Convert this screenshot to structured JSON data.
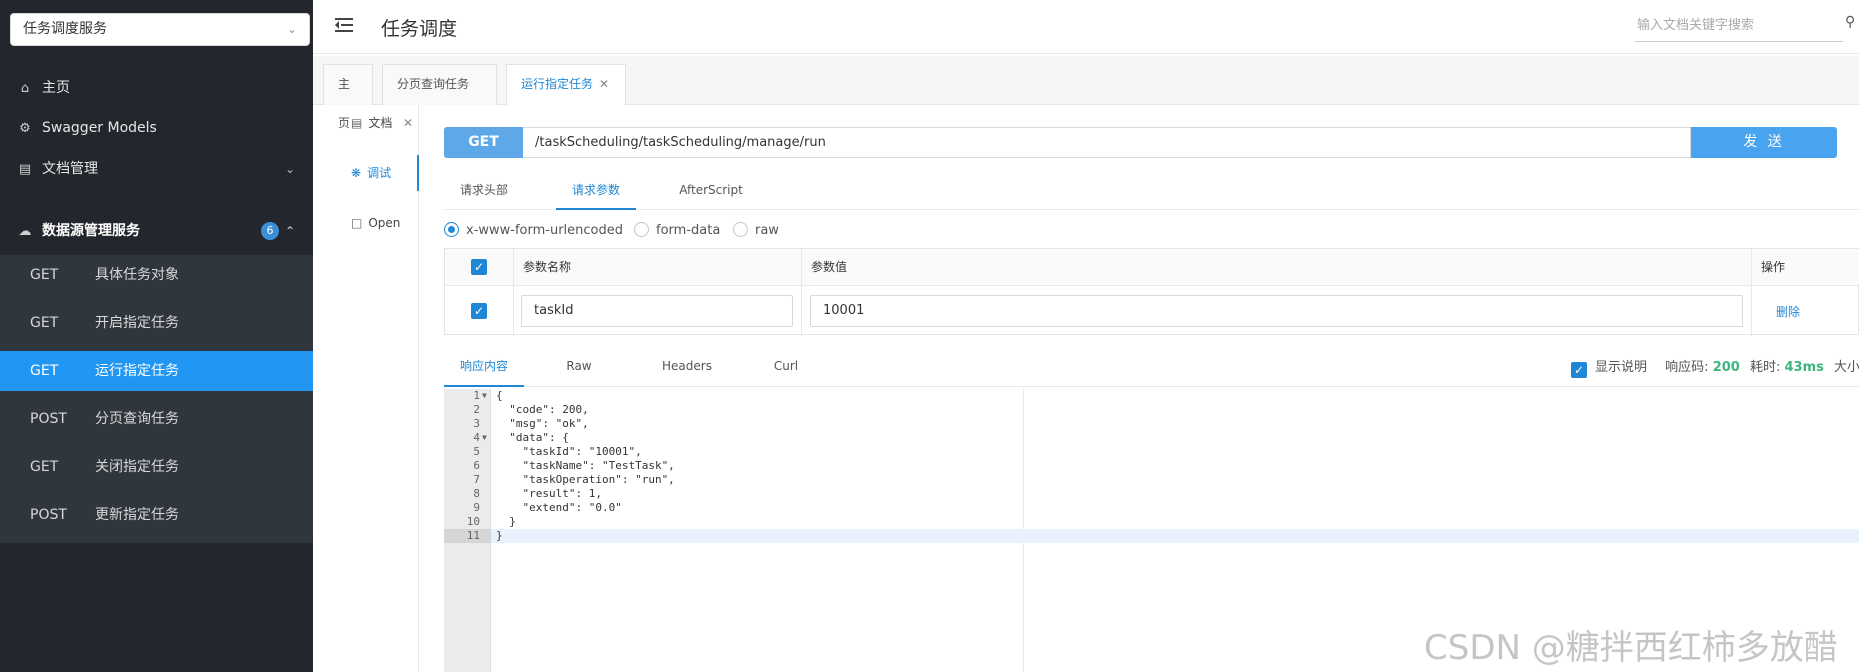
{
  "sidebar": {
    "service_select": "任务调度服务",
    "items": [
      {
        "label": "主页",
        "icon": "home-icon"
      },
      {
        "label": "Swagger Models",
        "icon": "gear-icon"
      },
      {
        "label": "文档管理",
        "icon": "document-icon"
      },
      {
        "label": "数据源管理服务",
        "icon": "cloud-icon",
        "badge": "6"
      }
    ],
    "submenu": [
      {
        "method": "GET",
        "label": "具体任务对象"
      },
      {
        "method": "GET",
        "label": "开启指定任务"
      },
      {
        "method": "GET",
        "label": "运行指定任务",
        "active": true
      },
      {
        "method": "POST",
        "label": "分页查询任务"
      },
      {
        "method": "GET",
        "label": "关闭指定任务"
      },
      {
        "method": "POST",
        "label": "更新指定任务"
      }
    ]
  },
  "header": {
    "title": "任务调度",
    "search_placeholder": "输入文档关键字搜索"
  },
  "tabs": [
    {
      "label": "主页"
    },
    {
      "label": "分页查询任务",
      "closable": true
    },
    {
      "label": "运行指定任务",
      "closable": true,
      "active": true
    }
  ],
  "inner_nav": [
    {
      "label": "文档",
      "icon": "document-icon"
    },
    {
      "label": "调试",
      "icon": "bug-icon",
      "active": true
    },
    {
      "label": "Open",
      "icon": "file-icon"
    }
  ],
  "request": {
    "method": "GET",
    "url": "/taskScheduling/taskScheduling/manage/run",
    "send_label": "发 送",
    "tabs": [
      "请求头部",
      "请求参数",
      "AfterScript"
    ],
    "active_tab": "请求参数",
    "content_types": [
      "x-www-form-urlencoded",
      "form-data",
      "raw"
    ],
    "selected_content_type": "x-www-form-urlencoded"
  },
  "params_table": {
    "headers": [
      "参数名称",
      "参数值",
      "操作"
    ],
    "rows": [
      {
        "name": "taskId",
        "value": "10001",
        "action": "删除",
        "checked": true
      }
    ]
  },
  "response": {
    "tabs": [
      "响应内容",
      "Raw",
      "Headers",
      "Curl"
    ],
    "active_tab": "响应内容",
    "show_desc_label": "显示说明",
    "status_label": "响应码:",
    "status_code": "200",
    "time_label": "耗时:",
    "time_value": "43ms",
    "size_label": "大小:",
    "line_numbers": [
      "1",
      "2",
      "3",
      "4",
      "5",
      "6",
      "7",
      "8",
      "9",
      "10",
      "11"
    ],
    "code_lines": [
      "{",
      "  \"code\": 200,",
      "  \"msg\": \"ok\",",
      "  \"data\": {",
      "    \"taskId\": \"10001\",",
      "    \"taskName\": \"TestTask\",",
      "    \"taskOperation\": \"run\",",
      "    \"result\": 1,",
      "    \"extend\": \"0.0\"",
      "  }",
      "}"
    ]
  },
  "watermark": "CSDN @糖拌西红柿多放醋",
  "colors": {
    "sidebar_bg": "#23272d",
    "accent": "#2196f3",
    "method_badge": "#5fa8e8",
    "send_button": "#48a4ef",
    "success_green": "#3db67e"
  }
}
